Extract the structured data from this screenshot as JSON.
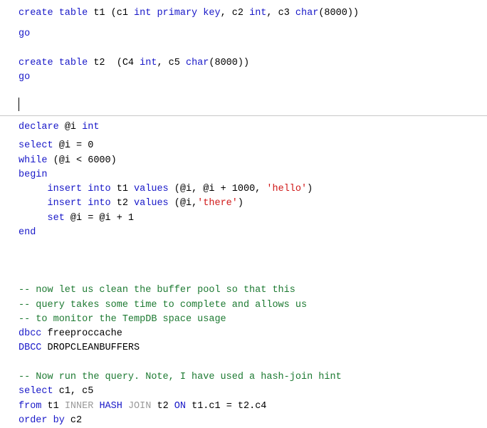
{
  "editor": {
    "type": "sql-query-editor",
    "caret": {
      "visible": true,
      "line": 6,
      "column": 1
    },
    "colors": {
      "keyword": "#1818c8",
      "string": "#d01818",
      "comment": "#1d7a32",
      "dim_keyword": "#9a9a9a",
      "plain": "#000000",
      "background": "#ffffff",
      "divider": "#c8c8c8"
    },
    "top_pane": {
      "lines": [
        {
          "id": "t1",
          "tokens": [
            {
              "t": "create table ",
              "c": "kw"
            },
            {
              "t": "t1 (c1 ",
              "c": "plain"
            },
            {
              "t": "int primary key",
              "c": "kw"
            },
            {
              "t": ", c2 ",
              "c": "plain"
            },
            {
              "t": "int",
              "c": "kw"
            },
            {
              "t": ", c3 ",
              "c": "plain"
            },
            {
              "t": "char",
              "c": "kw"
            },
            {
              "t": "(8000))",
              "c": "plain"
            }
          ]
        },
        {
          "id": "t2",
          "tokens": [
            {
              "t": "go",
              "c": "kw"
            }
          ]
        },
        {
          "id": "t3",
          "tokens": [
            {
              "t": "",
              "c": "plain"
            }
          ]
        },
        {
          "id": "t4",
          "tokens": [
            {
              "t": "create table ",
              "c": "kw"
            },
            {
              "t": "t2  (C4 ",
              "c": "plain"
            },
            {
              "t": "int",
              "c": "kw"
            },
            {
              "t": ", c5 ",
              "c": "plain"
            },
            {
              "t": "char",
              "c": "kw"
            },
            {
              "t": "(8000))",
              "c": "plain"
            }
          ]
        },
        {
          "id": "t5",
          "tokens": [
            {
              "t": "go",
              "c": "kw"
            }
          ]
        },
        {
          "id": "t6",
          "tokens": [
            {
              "t": "",
              "c": "plain"
            }
          ]
        },
        {
          "id": "t7",
          "tokens": [
            {
              "t": "",
              "c": "plain"
            }
          ]
        }
      ]
    },
    "bottom_pane": {
      "lines": [
        {
          "id": "b1",
          "tokens": [
            {
              "t": "declare ",
              "c": "kw"
            },
            {
              "t": "@i ",
              "c": "plain"
            },
            {
              "t": "int",
              "c": "kw"
            }
          ]
        },
        {
          "id": "b2",
          "tokens": [
            {
              "t": "select ",
              "c": "kw"
            },
            {
              "t": "@i = 0",
              "c": "plain"
            }
          ]
        },
        {
          "id": "b3",
          "tokens": [
            {
              "t": "while ",
              "c": "kw"
            },
            {
              "t": "(@i < 6000)",
              "c": "plain"
            }
          ]
        },
        {
          "id": "b4",
          "tokens": [
            {
              "t": "begin",
              "c": "kw"
            }
          ]
        },
        {
          "id": "b5",
          "tokens": [
            {
              "t": "     ",
              "c": "plain"
            },
            {
              "t": "insert into ",
              "c": "kw"
            },
            {
              "t": "t1 ",
              "c": "plain"
            },
            {
              "t": "values ",
              "c": "kw"
            },
            {
              "t": "(@i, @i + 1000, ",
              "c": "plain"
            },
            {
              "t": "'hello'",
              "c": "str"
            },
            {
              "t": ")",
              "c": "plain"
            }
          ]
        },
        {
          "id": "b6",
          "tokens": [
            {
              "t": "     ",
              "c": "plain"
            },
            {
              "t": "insert into ",
              "c": "kw"
            },
            {
              "t": "t2 ",
              "c": "plain"
            },
            {
              "t": "values ",
              "c": "kw"
            },
            {
              "t": "(@i,",
              "c": "plain"
            },
            {
              "t": "'there'",
              "c": "str"
            },
            {
              "t": ")",
              "c": "plain"
            }
          ]
        },
        {
          "id": "b7",
          "tokens": [
            {
              "t": "     ",
              "c": "plain"
            },
            {
              "t": "set ",
              "c": "kw"
            },
            {
              "t": "@i = @i + 1",
              "c": "plain"
            }
          ]
        },
        {
          "id": "b8",
          "tokens": [
            {
              "t": "end",
              "c": "kw"
            }
          ]
        },
        {
          "id": "b9",
          "tokens": [
            {
              "t": "",
              "c": "plain"
            }
          ]
        },
        {
          "id": "b10",
          "tokens": [
            {
              "t": "",
              "c": "plain"
            }
          ]
        },
        {
          "id": "b11",
          "tokens": [
            {
              "t": "",
              "c": "plain"
            }
          ]
        },
        {
          "id": "b12",
          "tokens": [
            {
              "t": "-- now let us clean the buffer pool so that this",
              "c": "cmt"
            }
          ]
        },
        {
          "id": "b13",
          "tokens": [
            {
              "t": "-- query takes some time to complete and allows us",
              "c": "cmt"
            }
          ]
        },
        {
          "id": "b14",
          "tokens": [
            {
              "t": "-- to monitor the TempDB space usage",
              "c": "cmt"
            }
          ]
        },
        {
          "id": "b15",
          "tokens": [
            {
              "t": "dbcc ",
              "c": "kw"
            },
            {
              "t": "freeproccache",
              "c": "plain"
            }
          ]
        },
        {
          "id": "b16",
          "tokens": [
            {
              "t": "DBCC ",
              "c": "kw"
            },
            {
              "t": "DROPCLEANBUFFERS",
              "c": "plain"
            }
          ]
        },
        {
          "id": "b17",
          "tokens": [
            {
              "t": "",
              "c": "plain"
            }
          ]
        },
        {
          "id": "b18",
          "tokens": [
            {
              "t": "-- Now run the query. Note, I have used a hash-join hint",
              "c": "cmt"
            }
          ]
        },
        {
          "id": "b19",
          "tokens": [
            {
              "t": "select ",
              "c": "kw"
            },
            {
              "t": "c1, c5",
              "c": "plain"
            }
          ]
        },
        {
          "id": "b20",
          "tokens": [
            {
              "t": "from ",
              "c": "kw"
            },
            {
              "t": "t1 ",
              "c": "plain"
            },
            {
              "t": "INNER ",
              "c": "dim"
            },
            {
              "t": "HASH ",
              "c": "kw"
            },
            {
              "t": "JOIN ",
              "c": "dim"
            },
            {
              "t": "t2 ",
              "c": "plain"
            },
            {
              "t": "ON ",
              "c": "kw"
            },
            {
              "t": "t1.c1 = t2.c4",
              "c": "plain"
            }
          ]
        },
        {
          "id": "b21",
          "tokens": [
            {
              "t": "order by ",
              "c": "kw"
            },
            {
              "t": "c2",
              "c": "plain"
            }
          ]
        }
      ]
    }
  }
}
